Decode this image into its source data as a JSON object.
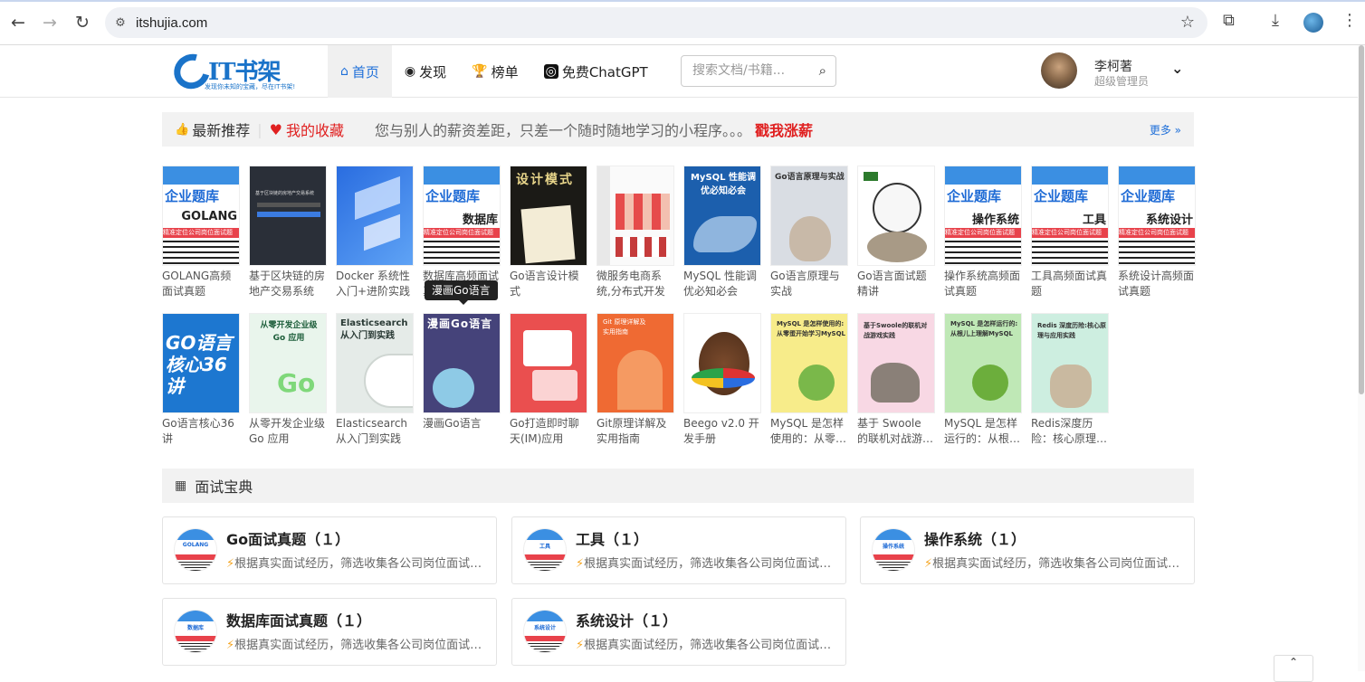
{
  "browser": {
    "url": "itshujia.com",
    "back_icon": "←",
    "forward_icon": "→",
    "reload_icon": "↻",
    "star_icon": "☆",
    "extension_icon": "⧉",
    "download_icon": "⤓",
    "menu_icon": "⋮"
  },
  "header": {
    "logo_name": "IT书架",
    "logo_tagline": "发现你未知的宝藏，尽在IT书架!",
    "menu": [
      {
        "label": "首页",
        "icon": "⌂",
        "active": true
      },
      {
        "label": "发现",
        "icon": "◉"
      },
      {
        "label": "榜单",
        "icon": "🏆"
      },
      {
        "label": "免费ChatGPT",
        "icon": "◎"
      }
    ],
    "search_placeholder": "搜索文档/书籍...",
    "search_icon": "⌕",
    "user_name": "李柯著",
    "user_role": "超级管理员",
    "chevron_icon": "⌄"
  },
  "recommend": {
    "tab_latest": "最新推荐",
    "tab_favorites": "我的收藏",
    "promo_text": "您与别人的薪资差距，只差一个随时随地学习的小程序。。。",
    "promo_link": "戳我涨薪",
    "more": "更多 »",
    "thumb_icon": "👍",
    "heart_icon": "♥"
  },
  "books": [
    {
      "title": "GOLANG高频面试真题",
      "cover": "qiye",
      "cover_sub": "GOLANG",
      "cover_title": "企业题库",
      "cover_strip": "精准定位公司岗位面试题"
    },
    {
      "title": "基于区块链的房地产交易系统",
      "cover": "dark",
      "cover_text": "基于区块链的房地产交易系统"
    },
    {
      "title": "Docker 系统性入门+进阶实践",
      "cover": "blue3d"
    },
    {
      "title": "数据库高频面试真题",
      "cover": "qiye",
      "cover_sub": "数据库",
      "cover_title": "企业题库",
      "cover_strip": "精准定位公司岗位面试题"
    },
    {
      "title": "Go语言设计模式",
      "cover": "design",
      "cover_text": "设计模式"
    },
    {
      "title": "微服务电商系统,分布式开发",
      "cover": "shop"
    },
    {
      "title": "MySQL 性能调优必知必会",
      "cover": "mysqlblue",
      "cover_text": "MySQL 性能调优必知必会"
    },
    {
      "title": "Go语言原理与实战",
      "cover": "gopher",
      "cover_text": "Go语言原理与实战"
    },
    {
      "title": "Go语言面试题精讲",
      "cover": "astro"
    },
    {
      "title": "操作系统高频面试真题",
      "cover": "qiye",
      "cover_sub": "操作系统",
      "cover_title": "企业题库",
      "cover_strip": "精准定位公司岗位面试题"
    },
    {
      "title": "工具高频面试真题",
      "cover": "qiye",
      "cover_sub": "工具",
      "cover_title": "企业题库",
      "cover_strip": "精准定位公司岗位面试题"
    },
    {
      "title": "系统设计高频面试真题",
      "cover": "qiye",
      "cover_sub": "系统设计",
      "cover_title": "企业题库",
      "cover_strip": "精准定位公司岗位面试题"
    },
    {
      "title": "Go语言核心36讲",
      "cover": "go36",
      "cover_text": "GO语言核心36讲"
    },
    {
      "title": "从零开发企业级 Go 应用",
      "cover": "greengo",
      "cover_text": "从零开发企业级 Go 应用"
    },
    {
      "title": "Elasticsearch 从入门到实践",
      "cover": "es",
      "cover_text": "Elasticsearch从入门到实践"
    },
    {
      "title": "漫画Go语言",
      "cover": "comic",
      "cover_text": "漫画Go语言"
    },
    {
      "title": "Go打造即时聊天(IM)应用",
      "cover": "im"
    },
    {
      "title": "Git原理详解及实用指南",
      "cover": "git",
      "cover_text": "Git 原理详解及实用指南"
    },
    {
      "title": "Beego v2.0 开发手册",
      "cover": "beego"
    },
    {
      "title": "MySQL 是怎样使用的：从零…",
      "cover": "yellow",
      "cover_text": "MySQL 是怎样使用的:从零蛋开始学习MySQL"
    },
    {
      "title": "基于 Swoole 的联机对战游戏…",
      "cover": "pink",
      "cover_text": "基于Swoole的联机对战游戏实践"
    },
    {
      "title": "MySQL 是怎样运行的：从根…",
      "cover": "green",
      "cover_text": "MySQL 是怎样运行的:从根儿上理解MySQL"
    },
    {
      "title": "Redis深度历险：核心原理…",
      "cover": "redis",
      "cover_text": "Redis 深度历险:核心原理与应用实践"
    }
  ],
  "tooltip": "漫画Go语言",
  "interview": {
    "section_title": "面试宝典",
    "grid_icon": "▦",
    "cards": [
      {
        "name": "Go面试真题（１）",
        "icon_text": "GOLANG",
        "desc": "根据真实面试经历，筛选收集各公司岗位面试真题"
      },
      {
        "name": "工具（１）",
        "icon_text": "工具",
        "desc": "根据真实面试经历，筛选收集各公司岗位面试真题"
      },
      {
        "name": "操作系统（１）",
        "icon_text": "操作系统",
        "desc": "根据真实面试经历，筛选收集各公司岗位面试真题"
      },
      {
        "name": "数据库面试真题（１）",
        "icon_text": "数据库",
        "desc": "根据真实面试经历，筛选收集各公司岗位面试真题"
      },
      {
        "name": "系统设计（１）",
        "icon_text": "系统设计",
        "desc": "根据真实面试经历，筛选收集各公司岗位面试真题"
      }
    ],
    "bolt_icon": "⚡"
  },
  "to_top_icon": "⌃"
}
